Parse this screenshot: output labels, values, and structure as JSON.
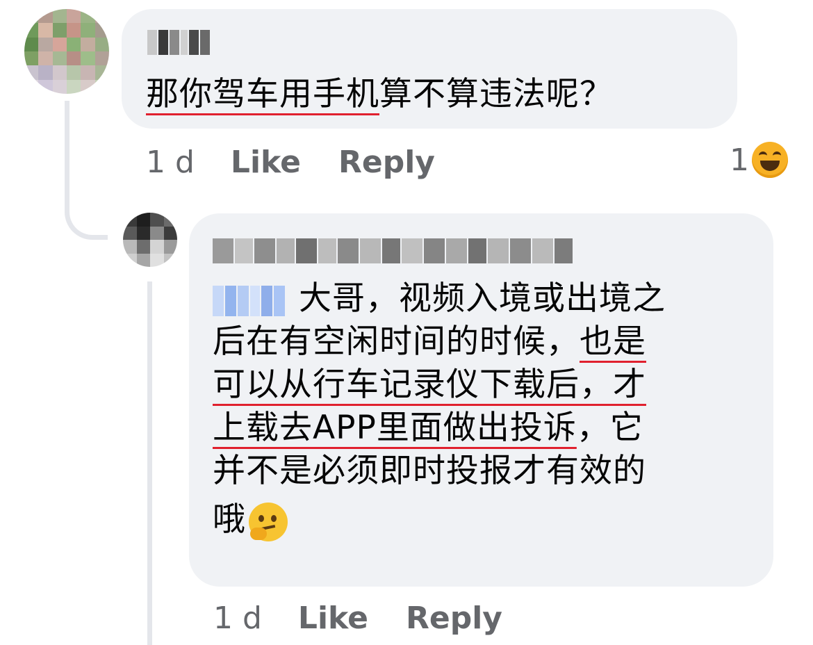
{
  "comment1": {
    "author_hidden": true,
    "text_underlined": "那你驾车用手机",
    "text_rest": "算不算违法呢？",
    "time": "1 d",
    "like_label": "Like",
    "reply_label": "Reply",
    "reaction_count": "1",
    "reaction_icon": "laughing-emoji-icon"
  },
  "comment2": {
    "author_hidden": true,
    "mention_hidden": true,
    "line1": "大哥，视频入境或出境之",
    "line2a": "后在有空闲时间的时候，",
    "line2b": "也是",
    "line3": "可以从行车记录仪下载后，才",
    "line4a": "上载去APP里面做出投诉",
    "line4b": "，它",
    "line5": "并不是必须即时投报才有效的",
    "line6": "哦",
    "trailing_emoji": "thinking-emoji-icon",
    "time": "1 d",
    "like_label": "Like",
    "reply_label": "Reply"
  },
  "colors": {
    "bubble": "#f0f2f5",
    "meta_text": "#65676b",
    "underline": "#e0202e",
    "mention_blur": "#a9c4f5"
  }
}
